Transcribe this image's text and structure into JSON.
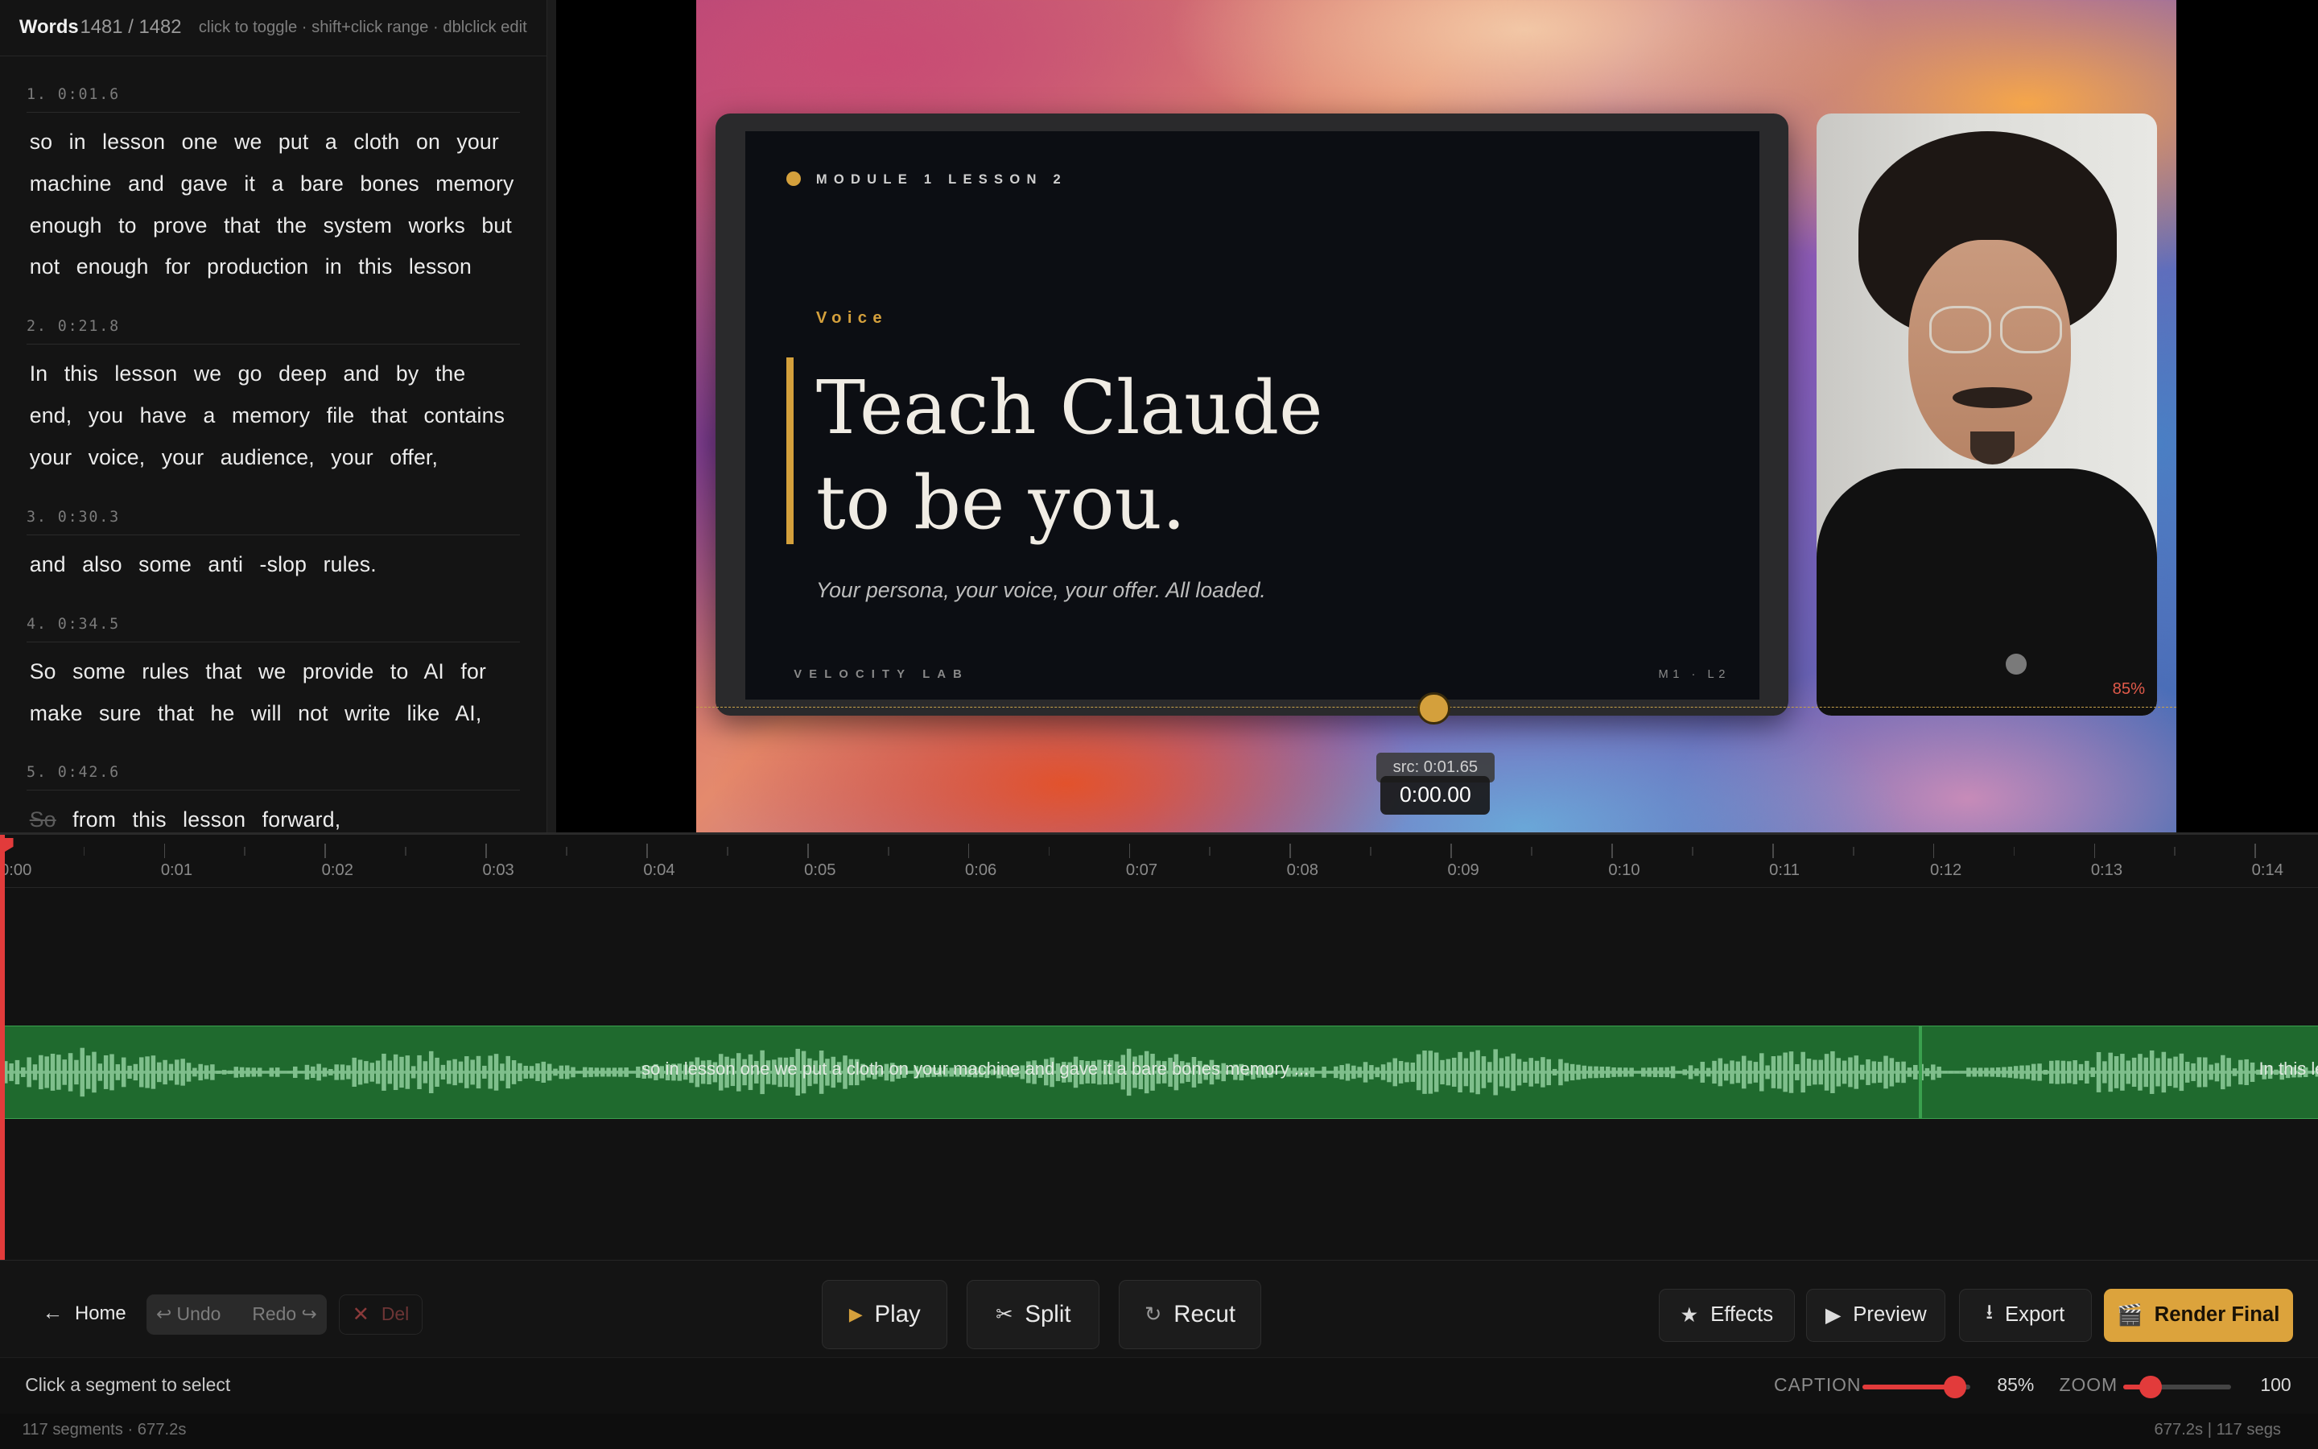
{
  "words_panel": {
    "title": "Words",
    "count": "1481 / 1482",
    "hint": "click to toggle · shift+click range · dblclick edit",
    "segments": [
      {
        "label": "1. 0:01.6",
        "text": "so in lesson one we put a cloth on your machine and gave it a bare bones memory enough to prove that the system works but not enough for production in this lesson"
      },
      {
        "label": "2. 0:21.8",
        "text": "In this lesson we go deep and by the end, you have a memory file that contains your voice, your audience, your offer,"
      },
      {
        "label": "3. 0:30.3",
        "text": "and also some anti -slop rules."
      },
      {
        "label": "4. 0:34.5",
        "text": "So some rules that we provide to AI for make sure that he will not write like AI,"
      },
      {
        "label": "5. 0:42.6",
        "deleted_word": "So",
        "text": "from this lesson forward,"
      }
    ]
  },
  "preview": {
    "slide": {
      "module": "MODULE 1   LESSON 2",
      "eyebrow": "Voice",
      "headline_line1": "Teach Claude",
      "headline_line2": "to be you.",
      "subtitle": "Your persona, your voice, your offer. All loaded.",
      "footer_left": "VELOCITY LAB",
      "footer_right": "M1 · L2",
      "accent": "#d4a03c"
    },
    "camera_scale": "85%",
    "source_time": "src: 0:01.65",
    "timecode": "0:00.00"
  },
  "timeline": {
    "ticks": [
      "0:00",
      "0:01",
      "0:02",
      "0:03",
      "0:04",
      "0:05",
      "0:06",
      "0:07",
      "0:08",
      "0:09",
      "0:10",
      "0:11",
      "0:12",
      "0:13",
      "0:14"
    ],
    "clip1_caption": "so in lesson one we put a cloth on your machine and gave it a bare bones memory ...",
    "clip2_caption": "In this le",
    "track_color": "#1f6a2e",
    "playhead_color": "#e23b3b"
  },
  "toolbar": {
    "home": "Home",
    "undo": "Undo",
    "redo": "Redo",
    "del": "Del",
    "play": "Play",
    "split": "Split",
    "recut": "Recut",
    "effects": "Effects",
    "preview": "Preview",
    "export": "Export",
    "render": "Render Final",
    "render_color": "#dca33c"
  },
  "status": {
    "hint": "Click a segment to select",
    "caption_label": "CAPTION",
    "caption_value": "85%",
    "caption_level": 0.85,
    "zoom_label": "ZOOM",
    "zoom_value": "100",
    "zoom_level": 0.25
  },
  "footer": {
    "left": "117 segments · 677.2s",
    "right": "677.2s | 117 segs"
  }
}
